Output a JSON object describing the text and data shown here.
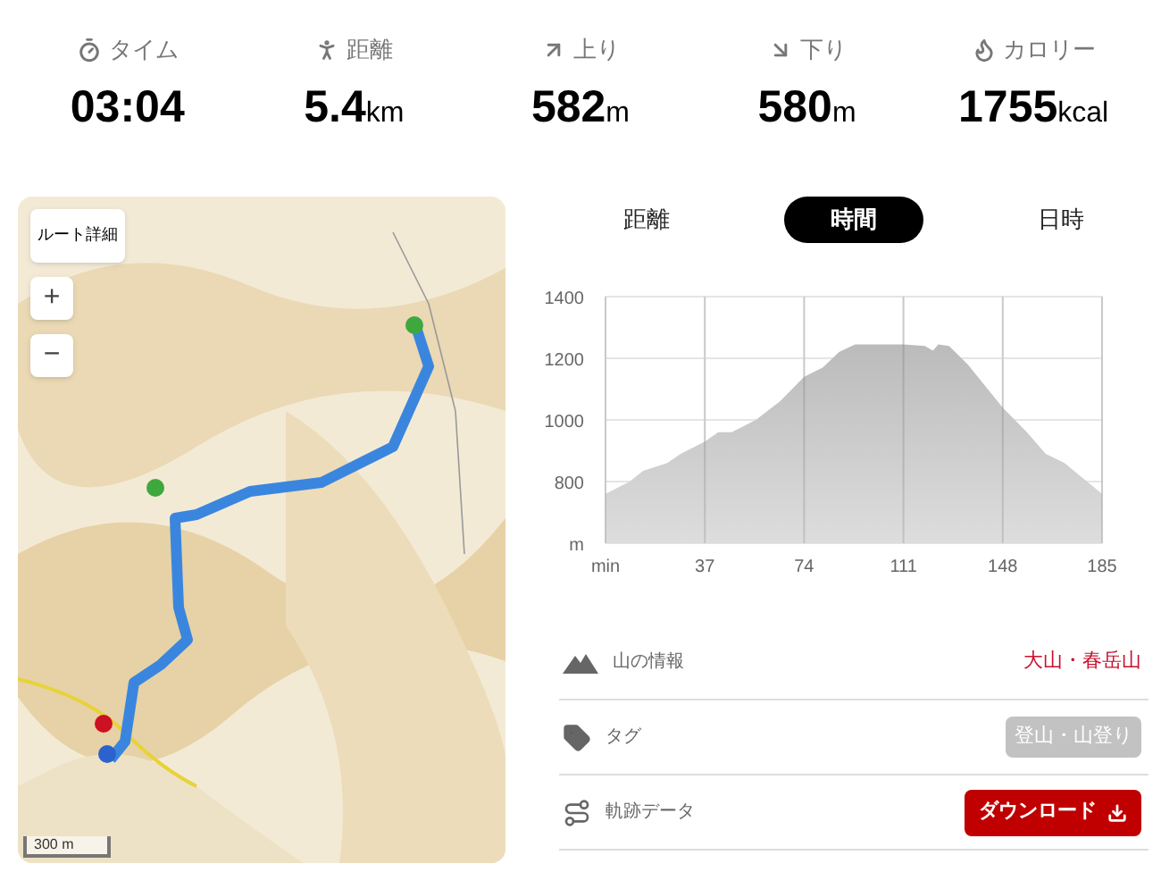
{
  "stats": [
    {
      "kind": "time",
      "label": "タイム",
      "value": "03:04"
    },
    {
      "kind": "distance",
      "label": "距離",
      "value": "5.4",
      "unit": "km"
    },
    {
      "kind": "ascent",
      "label": "上り",
      "value": "582",
      "unit": "m"
    },
    {
      "kind": "descent",
      "label": "下り",
      "value": "580",
      "unit": "m"
    },
    {
      "kind": "calories",
      "label": "カロリー",
      "value": "1755",
      "unit": "kcal"
    }
  ],
  "map": {
    "route_button": "ルート詳細",
    "zoom_in": "+",
    "zoom_out": "−",
    "scale": "300 m"
  },
  "tabs": [
    {
      "label": "距離",
      "selected": false
    },
    {
      "label": "時間",
      "selected": true
    },
    {
      "label": "日時",
      "selected": false
    }
  ],
  "chart": {
    "chart_data": {
      "type": "area",
      "x": [
        0,
        9,
        14,
        23,
        28,
        37,
        42,
        47,
        56,
        65,
        74,
        81,
        87,
        93,
        111,
        119,
        122,
        124,
        128,
        135,
        148,
        157,
        164,
        171,
        178,
        185
      ],
      "grid": true,
      "series": [
        {
          "color": "#bbbbbb",
          "values": [
            760,
            800,
            835,
            860,
            890,
            930,
            960,
            960,
            1000,
            1060,
            1140,
            1170,
            1220,
            1245,
            1245,
            1240,
            1225,
            1245,
            1240,
            1180,
            1040,
            960,
            890,
            860,
            810,
            760
          ]
        }
      ],
      "xlim": [
        0,
        185
      ],
      "ylim": [
        600,
        1400
      ],
      "xticks": [
        {
          "value": 0,
          "label": "min"
        },
        37,
        74,
        111,
        148,
        185
      ],
      "yticks": [
        {
          "value": 600,
          "label": "m"
        },
        800,
        1000,
        1200,
        1400
      ]
    }
  },
  "info": [
    {
      "kind": "mountain",
      "label": "山の情報",
      "value": "大山・春岳山"
    },
    {
      "kind": "tag",
      "label": "タグ",
      "value": "登山・山登り"
    },
    {
      "kind": "track",
      "label": "軌跡データ",
      "value": "ダウンロード"
    }
  ]
}
